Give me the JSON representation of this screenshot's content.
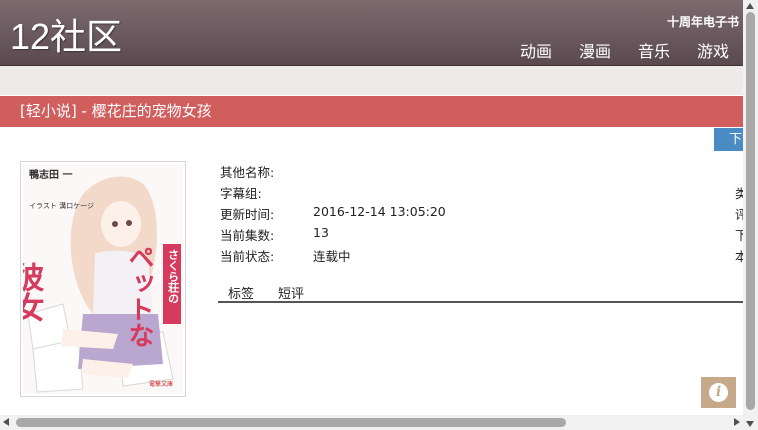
{
  "header": {
    "logo": "12社区",
    "promo": "十周年电子书",
    "nav": [
      "动画",
      "漫画",
      "音乐",
      "游戏"
    ]
  },
  "title_bar": {
    "text": "[轻小说] - 樱花庄的宠物女孩"
  },
  "download_button": {
    "label": "下载"
  },
  "info": {
    "rows": [
      {
        "label": "其他名称:",
        "value": ""
      },
      {
        "label": "字幕组:",
        "value": ""
      },
      {
        "label": "更新时间:",
        "value": "2016-12-14 13:05:20"
      },
      {
        "label": "当前集数:",
        "value": "13"
      },
      {
        "label": "当前状态:",
        "value": "连载中"
      }
    ],
    "right_column_chars": [
      "",
      "类",
      "评",
      "下",
      "本"
    ]
  },
  "tabs": [
    "标签",
    "短评"
  ],
  "info_button": {
    "icon": "info-icon"
  },
  "cover": {
    "author": "鴨志田 一",
    "illustrator": "イラスト 溝口ケージ",
    "title_big": "彼女",
    "title_kana": "ペットな",
    "title_small": "さくら荘の",
    "publisher": "電撃文庫"
  },
  "colors": {
    "header_bg": "#6b5a5f",
    "title_bar_bg": "#cf5e5d",
    "download_bg": "#4b8bc3",
    "info_btn_bg": "#c6a98a",
    "cover_red": "#d63a5c"
  }
}
